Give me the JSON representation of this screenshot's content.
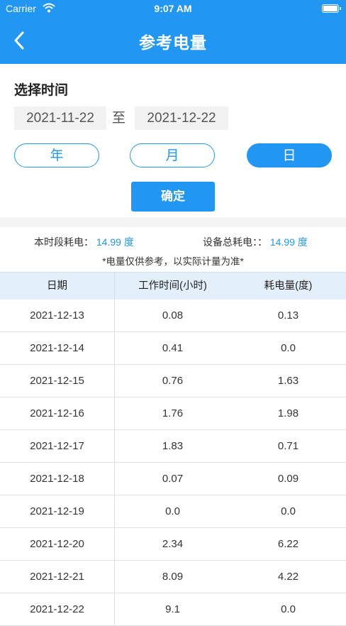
{
  "status": {
    "carrier": "Carrier",
    "time": "9:07 AM"
  },
  "nav": {
    "title": "参考电量"
  },
  "filter": {
    "label": "选择时间",
    "date_from": "2021-11-22",
    "to_label": "至",
    "date_to": "2021-12-22",
    "segments": [
      "年",
      "月",
      "日"
    ],
    "selected_segment": "日",
    "confirm_label": "确定"
  },
  "summary": {
    "period_label": "本时段耗电：",
    "period_value": "14.99 度",
    "total_label": "设备总耗电：：",
    "total_value": "14.99 度",
    "note": "*电量仅供参考，以实际计量为准*"
  },
  "colors": {
    "accent": "#2196f3",
    "header_bg": "#e3effa"
  },
  "table": {
    "headers": [
      "日期",
      "工作时间(小时)",
      "耗电量(度)"
    ],
    "rows": [
      [
        "2021-12-13",
        "0.08",
        "0.13"
      ],
      [
        "2021-12-14",
        "0.41",
        "0.0"
      ],
      [
        "2021-12-15",
        "0.76",
        "1.63"
      ],
      [
        "2021-12-16",
        "1.76",
        "1.98"
      ],
      [
        "2021-12-17",
        "1.83",
        "0.71"
      ],
      [
        "2021-12-18",
        "0.07",
        "0.09"
      ],
      [
        "2021-12-19",
        "0.0",
        "0.0"
      ],
      [
        "2021-12-20",
        "2.34",
        "6.22"
      ],
      [
        "2021-12-21",
        "8.09",
        "4.22"
      ],
      [
        "2021-12-22",
        "9.1",
        "0.0"
      ]
    ]
  }
}
